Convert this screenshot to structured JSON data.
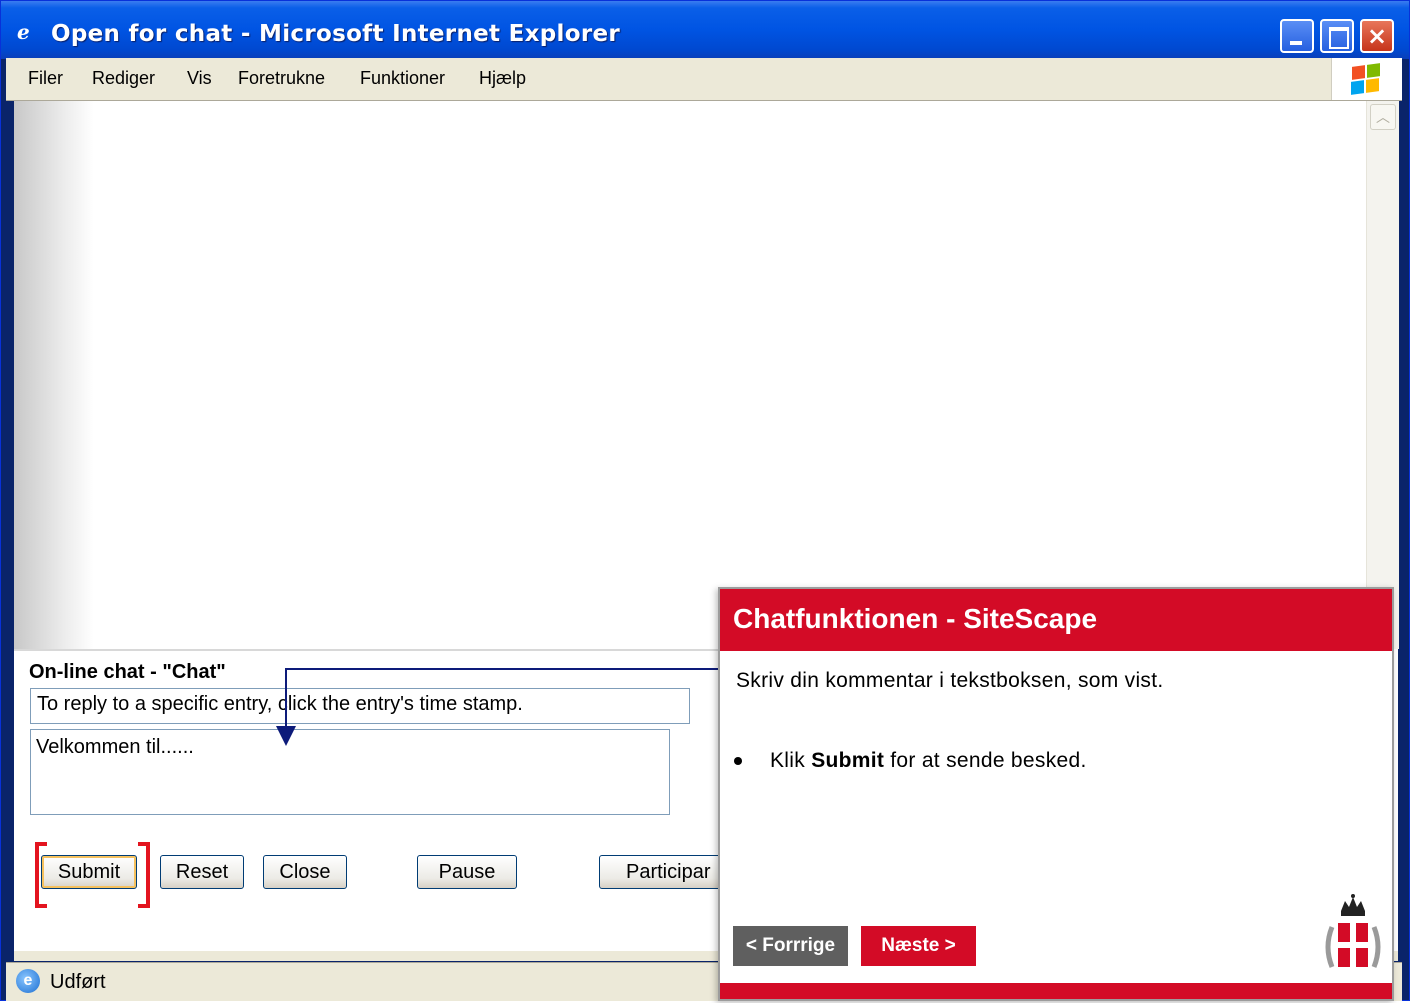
{
  "window": {
    "title": "Open for chat - Microsoft Internet Explorer",
    "controls": {
      "minimize": "minimize",
      "maximize": "maximize",
      "close": "×"
    }
  },
  "menubar": {
    "items": [
      "Filer",
      "Rediger",
      "Vis",
      "Foretrukne",
      "Funktioner",
      "Hjælp"
    ]
  },
  "chat": {
    "title": "On-line chat - \"Chat\"",
    "hint": "To reply to a specific entry, click the entry's time stamp.",
    "message_value": "Velkommen til......",
    "buttons": {
      "submit": "Submit",
      "reset": "Reset",
      "close": "Close",
      "pause": "Pause",
      "participants": "Participar"
    }
  },
  "statusbar": {
    "text": "Udført"
  },
  "tutorial": {
    "title": "Chatfunktionen - SiteScape",
    "instruction": "Skriv din kommentar i tekstboksen, som vist.",
    "bullet_prefix": "Klik ",
    "bullet_bold": "Submit",
    "bullet_suffix": " for at sende besked.",
    "prev_label": "< Forrrige",
    "next_label": "Næste >"
  },
  "colors": {
    "titlebar": "#0054e3",
    "tutorial_accent": "#d30b26",
    "highlight": "#e3141f",
    "arrow": "#0d1b7a"
  },
  "icons": [
    "ie-page-icon",
    "windows-logo-icon",
    "ie-status-icon",
    "royal-crest-icon",
    "scroll-up-icon"
  ]
}
